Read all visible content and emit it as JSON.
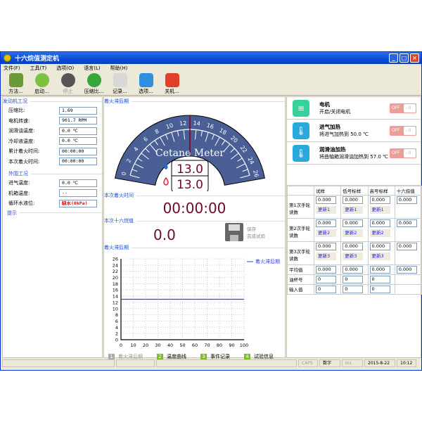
{
  "window": {
    "title": "十六烷值测定机"
  },
  "menu": [
    "文件(F)",
    "工具(T)",
    "选项(O)",
    "语言(L)",
    "帮助(H)"
  ],
  "toolbar": [
    {
      "label": "方法...",
      "icon": "method-book-icon",
      "color": "#6a9a3a",
      "disabled": false
    },
    {
      "label": "启动...",
      "icon": "play-icon",
      "color": "#7cc242",
      "disabled": false
    },
    {
      "label": "停止",
      "icon": "stop-icon",
      "color": "#555",
      "disabled": true
    },
    {
      "label": "压缩比...",
      "icon": "compression-icon",
      "color": "#3aa53a",
      "disabled": false
    },
    {
      "label": "记录...",
      "icon": "records-chart-icon",
      "color": "#d8d8d8",
      "disabled": false
    },
    {
      "label": "选项...",
      "icon": "gear-icon",
      "color": "#2f8ee0",
      "disabled": false
    },
    {
      "label": "关机...",
      "icon": "power-icon",
      "color": "#e0402a",
      "disabled": false
    }
  ],
  "engine": {
    "title": "发动机工况",
    "rows": [
      {
        "label": "压缩比:",
        "value": "1.69"
      },
      {
        "label": "电机转速:",
        "value": "901.7 RPM"
      },
      {
        "label": "润滑油温度:",
        "value": "0.0 ℃"
      },
      {
        "label": "冷却液温度:",
        "value": "0.0 ℃"
      },
      {
        "label": "累计着火时间:",
        "value": "00:00:00"
      },
      {
        "label": "本次着火时间:",
        "value": "00:00:00"
      }
    ]
  },
  "peripheral": {
    "title": "外围工况",
    "rows": [
      {
        "label": "进气温度:",
        "value": "0.0 ℃"
      },
      {
        "label": "机箱温度:",
        "value": "--"
      },
      {
        "label": "循环水液位:",
        "value": "缺水(0kPa)"
      }
    ]
  },
  "hint": {
    "title": "提示"
  },
  "gauge": {
    "section": "着火滞后期",
    "brand": "Cetane Meter",
    "ticks": [
      "0",
      "2",
      "4",
      "6",
      "8",
      "10",
      "12",
      "14",
      "16",
      "18",
      "20",
      "22",
      "24",
      "26"
    ],
    "min": 0,
    "max": 26,
    "needle": 13.0,
    "value1": "13.0",
    "value2": "13.0",
    "color": "#4a5f95"
  },
  "fire_time": {
    "section": "本次着火时间",
    "value": "00:00:00"
  },
  "cetane": {
    "section": "本次十六烷值",
    "value": "0.0",
    "save_label": "保存",
    "save_sub": "完成试验"
  },
  "chart_data": {
    "type": "line",
    "title": "着火滞后期",
    "xlim": [
      0,
      100
    ],
    "ylim": [
      0,
      26
    ],
    "xticks": [
      "0",
      "10",
      "20",
      "30",
      "40",
      "50",
      "60",
      "70",
      "80",
      "90",
      "100"
    ],
    "yticks": [
      "0",
      "2",
      "4",
      "6",
      "8",
      "10",
      "12",
      "14",
      "16",
      "18",
      "20",
      "22",
      "24",
      "26"
    ],
    "series": [
      {
        "name": "着火滞后期",
        "color": "#3344ee",
        "x": [
          0,
          100
        ],
        "y": [
          13,
          13
        ]
      }
    ],
    "grid": true,
    "legend": "top-right"
  },
  "bottom_tabs": [
    {
      "n": "1",
      "label": "着火滞后期",
      "active": false
    },
    {
      "n": "2",
      "label": "温度曲线"
    },
    {
      "n": "3",
      "label": "事件记录"
    },
    {
      "n": "4",
      "label": "试验信息"
    }
  ],
  "devices": [
    {
      "name": "电机",
      "desc": "开启/关闭电机",
      "icon": "motor-icon",
      "color": "#35d39a",
      "state": "OFF"
    },
    {
      "name": "进气加热",
      "desc": "将进气加热到 50.0 ℃",
      "icon": "thermometer-icon",
      "color": "#2aa8e0",
      "state": "OFF"
    },
    {
      "name": "润滑油加热",
      "desc": "将曲轴箱润滑油加热到 57.0 ℃",
      "icon": "thermometer-icon",
      "color": "#2aa8e0",
      "state": "OFF"
    }
  ],
  "readings": {
    "headers": [
      "",
      "试样",
      "低号标样",
      "高号标样",
      "十六烷值"
    ],
    "rounds": [
      {
        "label": "第1次手轮读数",
        "values": [
          "0.000",
          "0.000",
          "0.000",
          "0.000"
        ],
        "update": "更新1"
      },
      {
        "label": "第2次手轮读数",
        "values": [
          "0.000",
          "0.000",
          "0.000",
          "0.000"
        ],
        "update": "更新2"
      },
      {
        "label": "第3次手轮读数",
        "values": [
          "0.000",
          "0.000",
          "0.000",
          "0.000"
        ],
        "update": "更新3"
      }
    ],
    "avg": {
      "label": "平均值",
      "values": [
        "0.000",
        "0.000",
        "0.000",
        "0.000"
      ]
    },
    "cup": {
      "label": "油杯号",
      "values": [
        "0",
        "0",
        "0"
      ]
    },
    "input": {
      "label": "输入值",
      "values": [
        "0",
        "0",
        "0"
      ]
    }
  },
  "status": {
    "caps": "CAPS",
    "num": "数字",
    "ins": "Ins",
    "date": "2015-8-22",
    "time": "10:12"
  }
}
